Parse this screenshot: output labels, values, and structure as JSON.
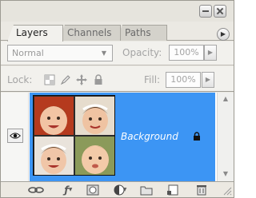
{
  "tabs": [
    {
      "label": "Layers",
      "active": true
    },
    {
      "label": "Channels",
      "active": false
    },
    {
      "label": "Paths",
      "active": false
    }
  ],
  "blend_mode": {
    "value": "Normal"
  },
  "opacity": {
    "label": "Opacity:",
    "value": "100%"
  },
  "lock": {
    "label": "Lock:"
  },
  "fill": {
    "label": "Fill:",
    "value": "100%"
  },
  "layers": [
    {
      "name": "Background",
      "visible": true,
      "selected": true,
      "locked": true
    }
  ],
  "icons": {
    "window": [
      "minimize-icon",
      "close-icon"
    ],
    "panel_menu": "panel-menu-icon",
    "lock_options": [
      "lock-transparent-icon",
      "lock-paint-icon",
      "lock-move-icon",
      "lock-all-icon"
    ],
    "bottom_toolbar": [
      "link-layers-icon",
      "layer-style-icon",
      "layer-mask-icon",
      "adjustment-layer-icon",
      "new-group-icon",
      "new-layer-icon",
      "delete-layer-icon"
    ]
  },
  "colors": {
    "selection": "#3c95f4",
    "panel_bg": "#ebe9e3"
  }
}
